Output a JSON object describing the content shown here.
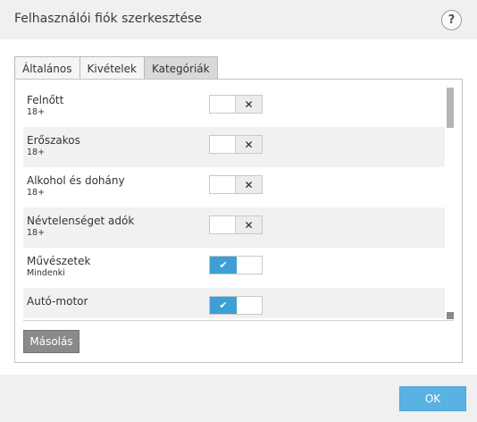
{
  "dialog": {
    "title": "Felhasználói fiók szerkesztése",
    "help_label": "?"
  },
  "tabs": [
    {
      "label": "Általános",
      "active": false
    },
    {
      "label": "Kivételek",
      "active": false
    },
    {
      "label": "Kategóriák",
      "active": true
    }
  ],
  "categories": [
    {
      "name": "Felnőtt",
      "age": "18+",
      "enabled": false
    },
    {
      "name": "Erőszakos",
      "age": "18+",
      "enabled": false
    },
    {
      "name": "Alkohol és dohány",
      "age": "18+",
      "enabled": false
    },
    {
      "name": "Névtelenséget adók",
      "age": "18+",
      "enabled": false
    },
    {
      "name": "Művészetek",
      "age": "Mindenki",
      "enabled": true
    },
    {
      "name": "Autó-motor",
      "age": "",
      "enabled": true
    }
  ],
  "toggle_glyphs": {
    "off": "✕",
    "on": "✔"
  },
  "buttons": {
    "copy": "Másolás",
    "ok": "OK"
  },
  "colors": {
    "toggle_on": "#3d9fd6",
    "ok_button": "#5ab2e3",
    "copy_button": "#8a8a8a"
  }
}
